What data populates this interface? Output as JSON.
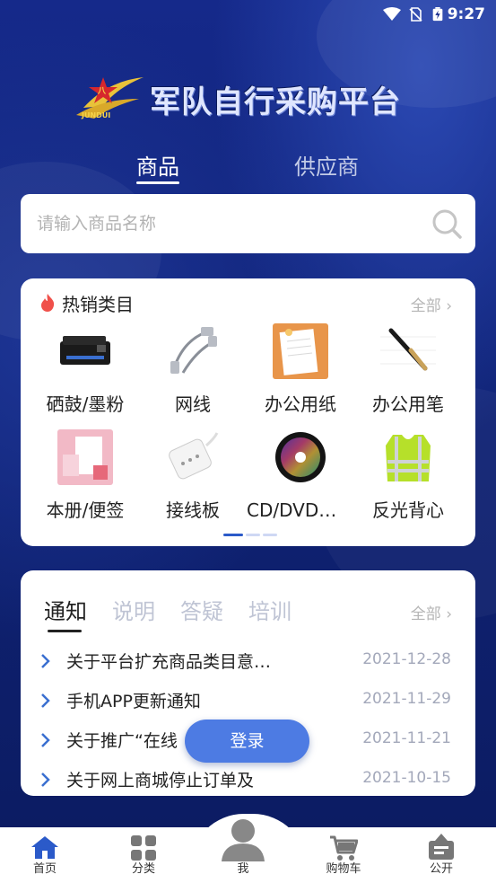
{
  "status_bar": {
    "time": "9:27"
  },
  "brand": {
    "logo_text": "JUNDUI",
    "title": "军队自行采购平台"
  },
  "top_tabs": [
    {
      "label": "商品",
      "active": true
    },
    {
      "label": "供应商",
      "active": false
    }
  ],
  "search": {
    "placeholder": "请输入商品名称",
    "value": ""
  },
  "hot_categories": {
    "title": "热销类目",
    "more_label": "全部",
    "items": [
      {
        "label": "硒鼓/墨粉",
        "icon": "toner-cartridge"
      },
      {
        "label": "网线",
        "icon": "network-cable"
      },
      {
        "label": "办公用纸",
        "icon": "office-paper"
      },
      {
        "label": "办公用笔",
        "icon": "office-pen"
      },
      {
        "label": "本册/便签",
        "icon": "notebook"
      },
      {
        "label": "接线板",
        "icon": "power-strip"
      },
      {
        "label": "CD/DVD刻…",
        "icon": "cd-dvd"
      },
      {
        "label": "反光背心",
        "icon": "reflective-vest"
      }
    ],
    "page_indicator": {
      "pages": 3,
      "current": 1
    }
  },
  "notices": {
    "tabs": [
      {
        "label": "通知",
        "active": true
      },
      {
        "label": "说明",
        "active": false
      },
      {
        "label": "答疑",
        "active": false
      },
      {
        "label": "培训",
        "active": false
      }
    ],
    "more_label": "全部",
    "items": [
      {
        "title": "关于平台扩充商品类目意…",
        "date": "2021-12-28"
      },
      {
        "title": "手机APP更新通知",
        "date": "2021-11-29"
      },
      {
        "title": "关于推广“在线",
        "date": "2021-11-21"
      },
      {
        "title": "关于网上商城停止订单及",
        "date": "2021-10-15"
      }
    ]
  },
  "login_button": {
    "label": "登录"
  },
  "bottom_nav": [
    {
      "label": "首页",
      "icon": "home-icon",
      "active": true
    },
    {
      "label": "分类",
      "icon": "grid-icon",
      "active": false
    },
    {
      "label": "我",
      "icon": "user-icon",
      "active": false
    },
    {
      "label": "购物车",
      "icon": "cart-icon",
      "active": false
    },
    {
      "label": "公开",
      "icon": "board-icon",
      "active": false
    }
  ],
  "colors": {
    "primary_blue": "#15298a",
    "accent_blue": "#4d7be3",
    "nav_active": "#2b5ac9"
  }
}
